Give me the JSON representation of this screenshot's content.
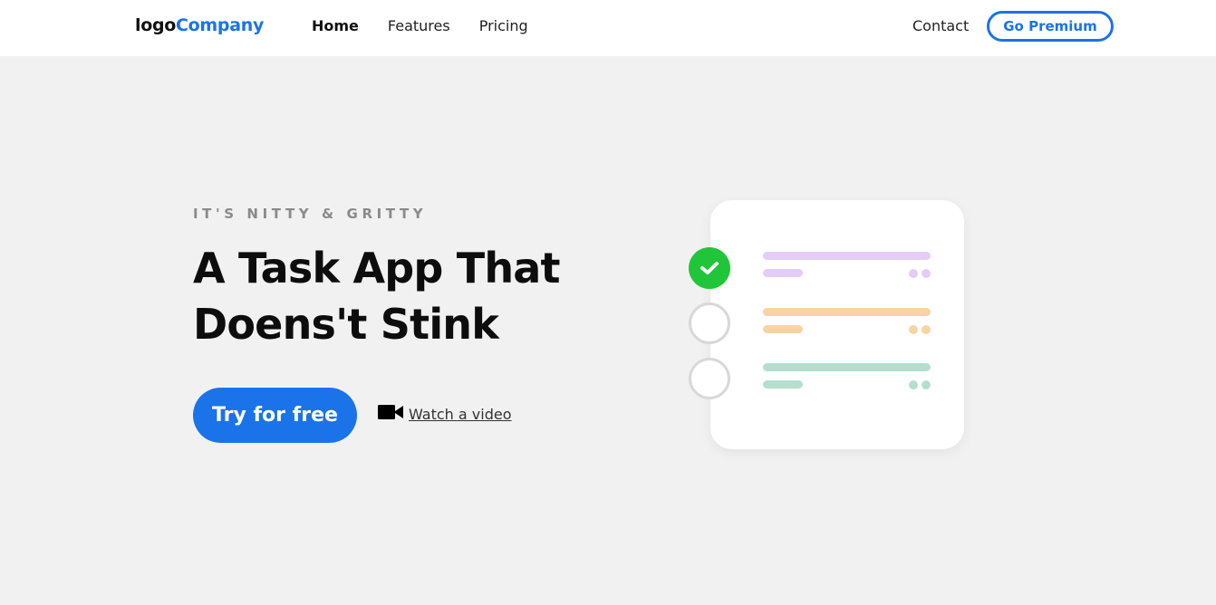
{
  "nav": {
    "logo_prefix": "logo",
    "logo_suffix": "Company",
    "links": [
      {
        "label": "Home",
        "active": true
      },
      {
        "label": "Features",
        "active": false
      },
      {
        "label": "Pricing",
        "active": false
      }
    ],
    "contact_label": "Contact",
    "premium_label": "Go Premium"
  },
  "hero": {
    "eyebrow": "IT'S NITTY & GRITTY",
    "headline": "A Task App That Doens't Stink",
    "cta_label": "Try for free",
    "video_icon": "video-camera-icon",
    "video_label": "Watch a video"
  },
  "illustration": {
    "tasks": [
      {
        "status": "done",
        "color": "#e3cdf4"
      },
      {
        "status": "todo",
        "color": "#f7d4a2"
      },
      {
        "status": "todo",
        "color": "#b4dfcc"
      }
    ],
    "check_icon": "check-icon"
  },
  "colors": {
    "accent": "#1a73e8",
    "success": "#20c53a",
    "background": "#f1f1f1"
  }
}
